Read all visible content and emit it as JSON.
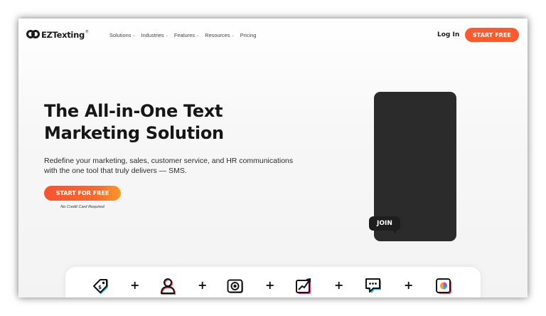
{
  "brand": {
    "name": "EZTexting",
    "tm": "®"
  },
  "nav": {
    "items": [
      {
        "label": "Solutions",
        "dropdown": true
      },
      {
        "label": "Industries",
        "dropdown": true
      },
      {
        "label": "Features",
        "dropdown": true
      },
      {
        "label": "Resources",
        "dropdown": true
      },
      {
        "label": "Pricing",
        "dropdown": false
      }
    ],
    "chevron": "⌄"
  },
  "header": {
    "login_label": "Log In",
    "start_label": "START FREE"
  },
  "hero": {
    "title_line1": "The All-in-One Text",
    "title_line2": "Marketing Solution",
    "subtitle_line1": "Redefine your marketing, sales, customer service, and HR communications",
    "subtitle_line2": "with the one tool that truly delivers — SMS.",
    "cta_label": "START FOR FREE",
    "cta_note": "No Credit Card Required"
  },
  "phone": {
    "join_label": "JOIN"
  },
  "features": {
    "icons": [
      "tag-icon",
      "contact-icon",
      "camera-icon",
      "growth-chart-icon",
      "chat-bubble-icon",
      "analytics-icon"
    ],
    "separator": "+"
  },
  "colors": {
    "brand_orange": "#fa5b30",
    "dark": "#161616",
    "phone_dark": "#2b2b2b"
  }
}
